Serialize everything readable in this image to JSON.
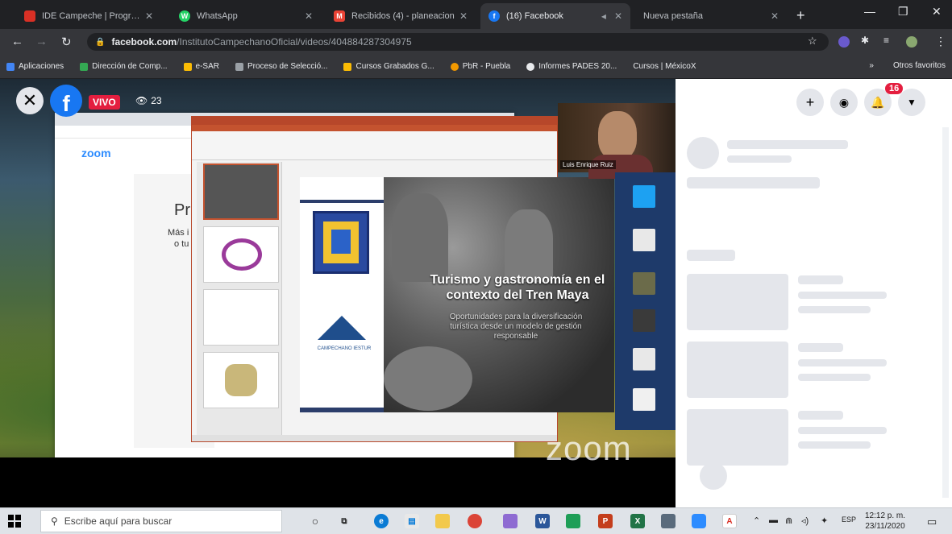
{
  "browser": {
    "tabs": [
      {
        "label": "IDE Campeche | Programa",
        "fav_color": "#d93025",
        "fav_glyph": "",
        "active": false
      },
      {
        "label": "WhatsApp",
        "fav_color": "#25d366",
        "fav_glyph": "W",
        "active": false
      },
      {
        "label": "Recibidos (4) - planeacion",
        "fav_color": "#ea4335",
        "fav_glyph": "M",
        "active": false
      },
      {
        "label": "(16) Facebook",
        "fav_color": "#1877f2",
        "fav_glyph": "f",
        "active": true
      },
      {
        "label": "Nueva pestaña",
        "fav_color": "#5f6368",
        "fav_glyph": "",
        "active": false
      }
    ],
    "url_host": "facebook.com",
    "url_path": "/InstitutoCampechanoOficial/videos/404884287304975",
    "bookmarks": [
      {
        "label": "Aplicaciones",
        "color": "#4285f4"
      },
      {
        "label": "Dirección de Comp...",
        "color": "#34a853"
      },
      {
        "label": "e-SAR",
        "color": "#fbbc04"
      },
      {
        "label": "Proceso de Selecció...",
        "color": "#9aa0a6"
      },
      {
        "label": "Cursos Grabados G...",
        "color": "#fbbc04"
      },
      {
        "label": "PbR - Puebla",
        "color": "#f29900"
      },
      {
        "label": "Informes PADES 20...",
        "color": "#e8eaed"
      },
      {
        "label": "Cursos | MéxicoX",
        "color": "#35363a"
      }
    ],
    "bookmarks_overflow": "»",
    "other_bookmarks": "Otros favoritos"
  },
  "video": {
    "live_label": "VIVO",
    "viewer_count": "23",
    "zoom_logo": "zoom",
    "zoom_watermark": "zoom",
    "zoom_slide_heading": "Pr",
    "zoom_slide_line1": "Más i",
    "zoom_slide_line2": "o tu",
    "webcam_name": "Luis Enrique Ruiz",
    "slide": {
      "title": "Turismo y gastronomía en el contexto del Tren Maya",
      "subtitle": "Oportunidades para la diversificación turística desde un modelo de gestión responsable",
      "institution": "CAMPECHANO IESTUR"
    }
  },
  "facebook": {
    "notification_count": "16"
  },
  "taskbar": {
    "search_placeholder": "Escribe aquí para buscar",
    "language": "ESP",
    "time": "12:12 p. m.",
    "date": "23/11/2020"
  }
}
